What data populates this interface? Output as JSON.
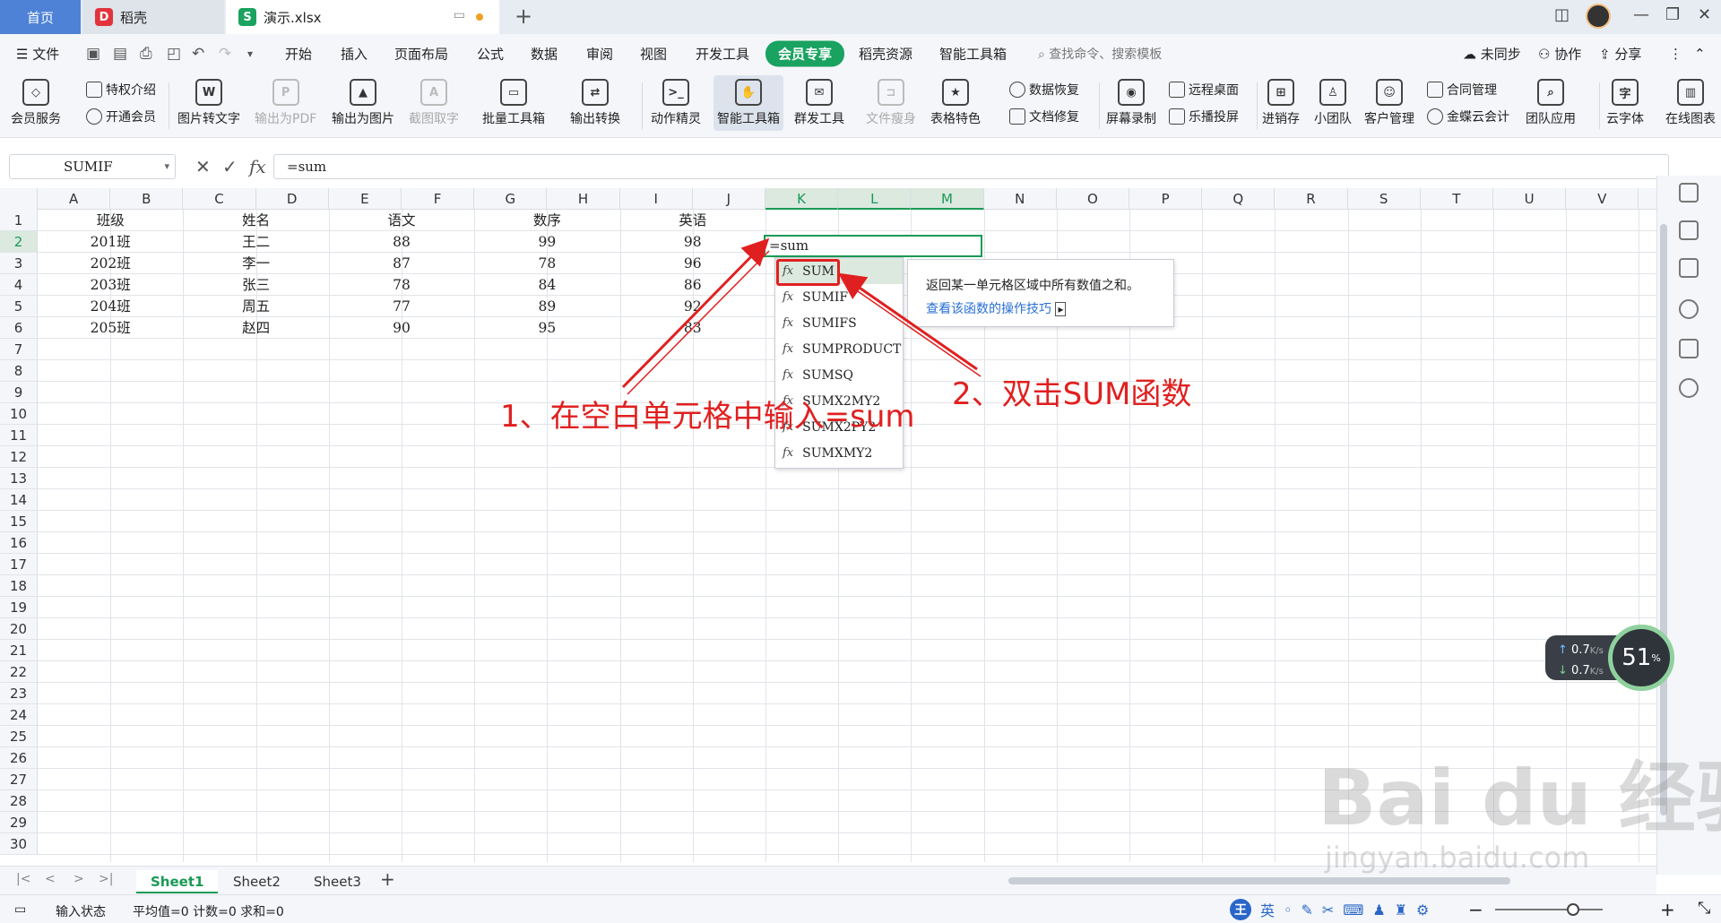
{
  "tabs": {
    "home": "首页",
    "daoke": "稻壳",
    "file": "演示.xlsx",
    "daoke_logo": "D",
    "file_logo": "S"
  },
  "menu": {
    "file": "文件",
    "items": [
      "开始",
      "插入",
      "页面布局",
      "公式",
      "数据",
      "审阅",
      "视图",
      "开发工具",
      "会员专享",
      "稻壳资源",
      "智能工具箱"
    ],
    "search": "查找命令、搜索模板",
    "sync": "未同步",
    "collab": "协作",
    "share": "分享"
  },
  "ribbon": {
    "member_service": "会员服务",
    "privilege_intro": "特权介绍",
    "open_member": "开通会员",
    "img_to_text": "图片转文字",
    "export_pdf": "输出为PDF",
    "export_img": "输出为图片",
    "screenshot_text": "截图取字",
    "batch_tools": "批量工具箱",
    "output_convert": "输出转换",
    "action_wizard": "动作精灵",
    "smart_toolbox": "智能工具箱",
    "mass_tools": "群发工具",
    "file_slim": "文件瘦身",
    "table_features": "表格特色",
    "data_recovery": "数据恢复",
    "doc_repair": "文档修复",
    "screen_record": "屏幕录制",
    "remote_desktop": "远程桌面",
    "cast_screen": "乐播投屏",
    "inventory": "进销存",
    "small_team": "小团队",
    "crm": "客户管理",
    "contract": "合同管理",
    "kingdee": "金蝶云会计",
    "team_apps": "团队应用",
    "cloud_font": "云字体",
    "online_chart": "在线图表"
  },
  "formula_bar": {
    "name_box": "SUMIF",
    "fx": "fx",
    "content": "=sum"
  },
  "grid": {
    "columns": [
      "A",
      "B",
      "C",
      "D",
      "E",
      "F",
      "G",
      "H",
      "I",
      "J",
      "K",
      "L",
      "M",
      "N",
      "O",
      "P",
      "Q",
      "R",
      "S",
      "T",
      "U",
      "V"
    ],
    "rows": [
      "1",
      "2",
      "3",
      "4",
      "5",
      "6",
      "7",
      "8",
      "9",
      "10",
      "11",
      "12",
      "13",
      "14",
      "15",
      "16",
      "17",
      "18",
      "19",
      "20",
      "21",
      "22",
      "23",
      "24",
      "25",
      "26",
      "27",
      "28",
      "29",
      "30"
    ],
    "headers": [
      "班级",
      "姓名",
      "语文",
      "数序",
      "英语"
    ],
    "data": [
      [
        "201班",
        "王二",
        "88",
        "99",
        "98"
      ],
      [
        "202班",
        "李一",
        "87",
        "78",
        "96"
      ],
      [
        "203班",
        "张三",
        "78",
        "84",
        "86"
      ],
      [
        "204班",
        "周五",
        "77",
        "89",
        "92"
      ],
      [
        "205班",
        "赵四",
        "90",
        "95",
        "83"
      ]
    ],
    "active_cell_text": "=sum"
  },
  "autocomplete": {
    "items": [
      "SUM",
      "SUMIF",
      "SUMIFS",
      "SUMPRODUCT",
      "SUMSQ",
      "SUMX2MY2",
      "SUMX2PY2",
      "SUMXMY2"
    ],
    "fx_label": "fx",
    "tip_text": "返回某一单元格区域中所有数值之和。",
    "tip_link": "查看该函数的操作技巧"
  },
  "annotations": {
    "step1": "1、在空白单元格中输入=sum",
    "step2": "2、双击SUM函数",
    "color": "#e02020"
  },
  "network": {
    "up": "0.7",
    "down": "0.7",
    "unit": "K/s",
    "percent": "51",
    "percent_sign": "%"
  },
  "sheets": [
    "Sheet1",
    "Sheet2",
    "Sheet3"
  ],
  "status": {
    "mode": "输入状态",
    "stats": "平均值=0  计数=0  求和=0",
    "ime_logo": "王",
    "ime_lang": "英"
  },
  "watermark": {
    "main": "Bai du 经验",
    "sub": "jingyan.baidu.com"
  },
  "colors": {
    "accent_green": "#1a9a56",
    "home_tab_blue": "#4d82d6",
    "annotation_red": "#e02020"
  }
}
